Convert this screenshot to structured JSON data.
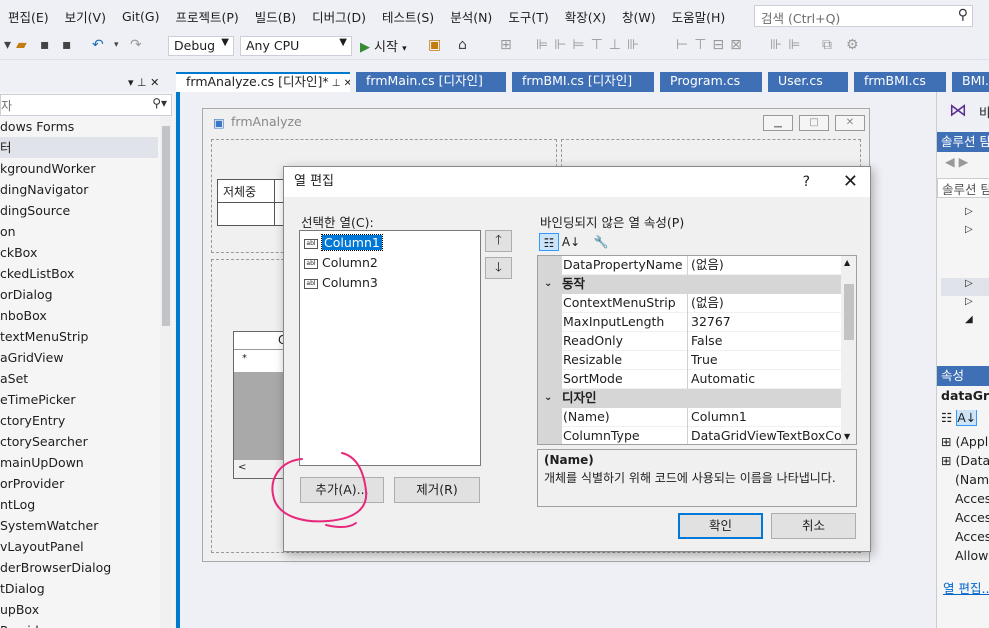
{
  "menu": [
    "편집(E)",
    "보기(V)",
    "Git(G)",
    "프로젝트(P)",
    "빌드(B)",
    "디버그(D)",
    "테스트(S)",
    "분석(N)",
    "도구(T)",
    "확장(X)",
    "창(W)",
    "도움말(H)"
  ],
  "search": {
    "placeholder": "검색 (Ctrl+Q)"
  },
  "toolbar": {
    "config": "Debug",
    "platform": "Any CPU",
    "start": "시작"
  },
  "toolbox": {
    "search_placeholder": "자",
    "items": [
      "dows Forms",
      "터",
      "kgroundWorker",
      "dingNavigator",
      "dingSource",
      "on",
      "ckBox",
      "ckedListBox",
      "orDialog",
      "nboBox",
      "textMenuStrip",
      "aGridView",
      "aSet",
      "eTimePicker",
      "ctoryEntry",
      "ctorySearcher",
      "mainUpDown",
      "orProvider",
      "ntLog",
      "SystemWatcher",
      "vLayoutPanel",
      "derBrowserDialog",
      "tDialog",
      "upBox",
      "Provider"
    ]
  },
  "tabs": [
    "frmAnalyze.cs [디자인]*",
    "frmMain.cs [디자인]",
    "frmBMI.cs [디자인]",
    "Program.cs",
    "User.cs",
    "frmBMI.cs",
    "BMI.cs"
  ],
  "form": {
    "title": "frmAnalyze",
    "cell_label": "저체중",
    "grid_col": "C",
    "grid_star": "*"
  },
  "right_panel": {
    "header_letter": "비",
    "solution": "솔루션 탐",
    "solution_search": "솔루션 탐",
    "props_title": "속성",
    "props_object": "dataGrid",
    "props_rows": [
      "(Applic",
      "(DataB",
      "(Name",
      "Access",
      "Access",
      "Access",
      "AllowD"
    ],
    "link": "열 편집..."
  },
  "dialog": {
    "title": "열 편집",
    "help": "?",
    "selected_label": "선택한 열(C):",
    "columns": [
      "Column1",
      "Column2",
      "Column3"
    ],
    "add_button": "추가(A)...",
    "remove_button": "제거(R)",
    "props_label": "바인딩되지 않은 열 속성(P)",
    "grid": [
      {
        "type": "row",
        "k": "DataPropertyName",
        "v": "(없음)"
      },
      {
        "type": "cat",
        "k": "동작"
      },
      {
        "type": "row",
        "k": "ContextMenuStrip",
        "v": "(없음)"
      },
      {
        "type": "row",
        "k": "MaxInputLength",
        "v": "32767"
      },
      {
        "type": "row",
        "k": "ReadOnly",
        "v": "False"
      },
      {
        "type": "row",
        "k": "Resizable",
        "v": "True"
      },
      {
        "type": "row",
        "k": "SortMode",
        "v": "Automatic"
      },
      {
        "type": "cat",
        "k": "디자인"
      },
      {
        "type": "row",
        "k": "(Name)",
        "v": "Column1"
      },
      {
        "type": "row",
        "k": "ColumnType",
        "v": "DataGridViewTextBoxColum"
      }
    ],
    "desc_title": "(Name)",
    "desc_text": "개체를 식별하기 위해 코드에 사용되는 이름을 나타냅니다.",
    "ok": "확인",
    "cancel": "취소"
  },
  "colors": {
    "accent": "#007acc",
    "tab_inactive": "#3f6fb5",
    "selection": "#0078d7",
    "annotation": "#e8287c"
  }
}
